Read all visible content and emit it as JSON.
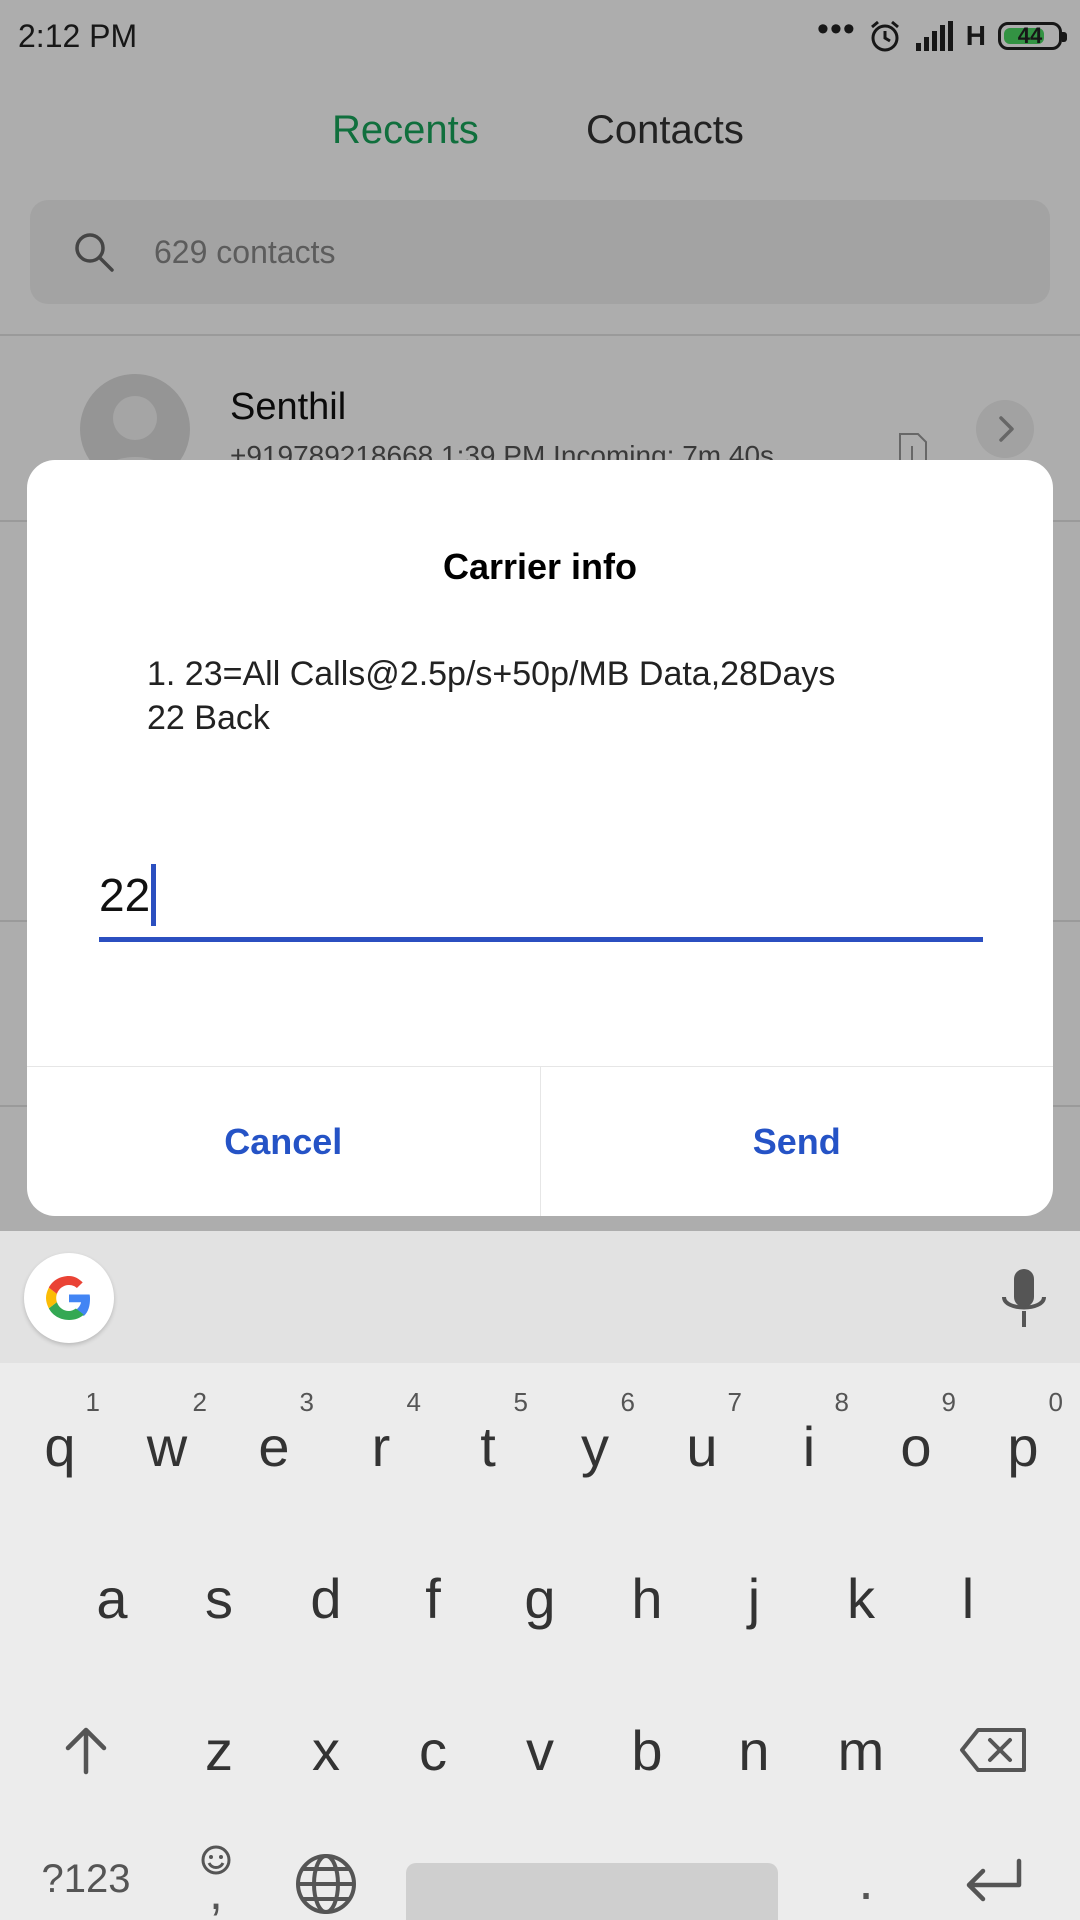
{
  "status_bar": {
    "time": "2:12 PM",
    "signal_type": "H",
    "battery_level": "44",
    "icons": [
      "more-dots-icon",
      "alarm-icon",
      "signal-icon",
      "battery-icon"
    ]
  },
  "tabs": {
    "recents": "Recents",
    "contacts": "Contacts"
  },
  "search": {
    "placeholder": "629 contacts"
  },
  "call_log": [
    {
      "name": "Senthil",
      "detail": "+919789218668  1:39 PM Incoming: 7m 40s"
    }
  ],
  "dialog": {
    "title": "Carrier info",
    "message": "1.  23=All Calls@2.5p/s+50p/MB Data,28Days\n22 Back",
    "input_value": "22",
    "cancel_label": "Cancel",
    "send_label": "Send"
  },
  "keyboard": {
    "row1": [
      {
        "key": "q",
        "hint": "1"
      },
      {
        "key": "w",
        "hint": "2"
      },
      {
        "key": "e",
        "hint": "3"
      },
      {
        "key": "r",
        "hint": "4"
      },
      {
        "key": "t",
        "hint": "5"
      },
      {
        "key": "y",
        "hint": "6"
      },
      {
        "key": "u",
        "hint": "7"
      },
      {
        "key": "i",
        "hint": "8"
      },
      {
        "key": "o",
        "hint": "9"
      },
      {
        "key": "p",
        "hint": "0"
      }
    ],
    "row2": [
      "a",
      "s",
      "d",
      "f",
      "g",
      "h",
      "j",
      "k",
      "l"
    ],
    "row3": [
      "z",
      "x",
      "c",
      "v",
      "b",
      "n",
      "m"
    ],
    "symbols_label": "?123",
    "comma_label": ",",
    "period_label": "."
  },
  "colors": {
    "accent_green": "#18a45a",
    "dialog_blue": "#2553c6",
    "battery_green": "#4cd964"
  }
}
